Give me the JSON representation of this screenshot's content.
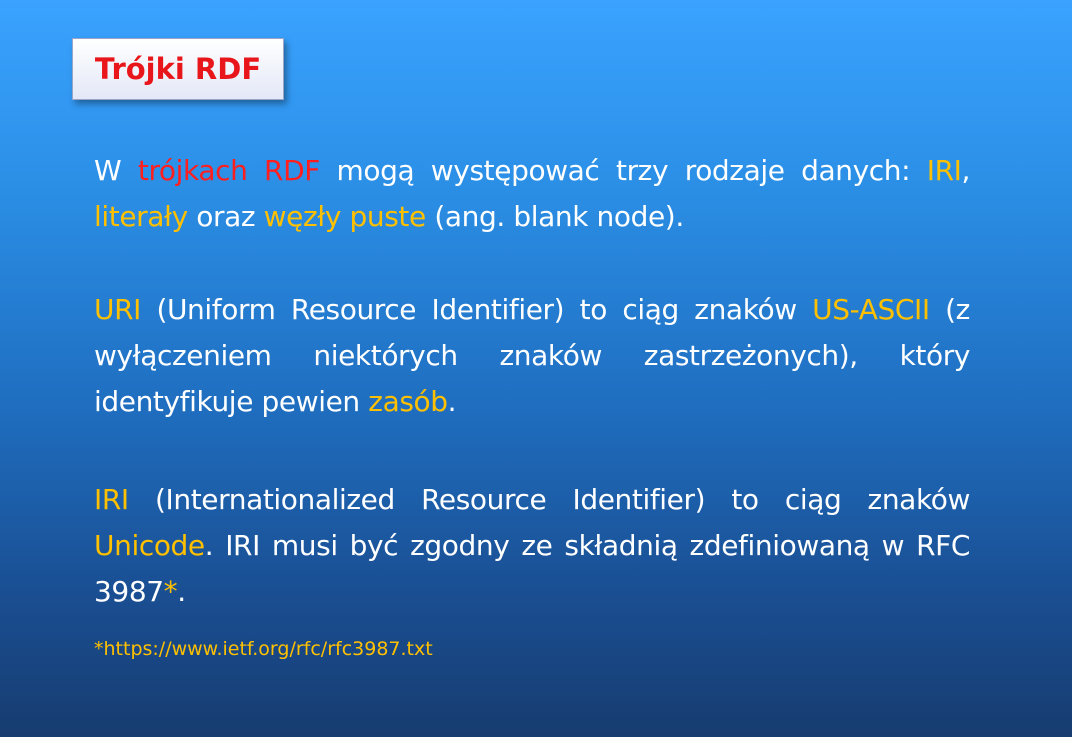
{
  "title": "Trójki RDF",
  "colors": {
    "accent_red": "#ff1f1f",
    "accent_yellow": "#ffc000",
    "text": "#ffffff"
  },
  "paragraph1": {
    "t1": "W ",
    "t2": "trójkach RDF",
    "t3": " mogą występować trzy rodzaje danych: ",
    "t4": "IRI",
    "t5": ", ",
    "t6": "literały",
    "t7": " oraz ",
    "t8": "węzły puste",
    "t9": " (ang. blank node)."
  },
  "paragraph2": {
    "t1": "URI",
    "t2": " (Uniform Resource Identifier) to ciąg znaków ",
    "t3": "US-ASCII",
    "t4": " (z wyłączeniem niektórych znaków zastrzeżonych), który identyfikuje pewien ",
    "t5": "zasób",
    "t6": "."
  },
  "paragraph3": {
    "t1": "IRI",
    "t2": " (Internationalized Resource Identifier) to ciąg znaków ",
    "t3": "Unicode",
    "t4": ". IRI musi być zgodny ze składnią zdefiniowaną w RFC 3987",
    "t5": "*",
    "t6": "."
  },
  "footnote": "*https://www.ietf.org/rfc/rfc3987.txt"
}
